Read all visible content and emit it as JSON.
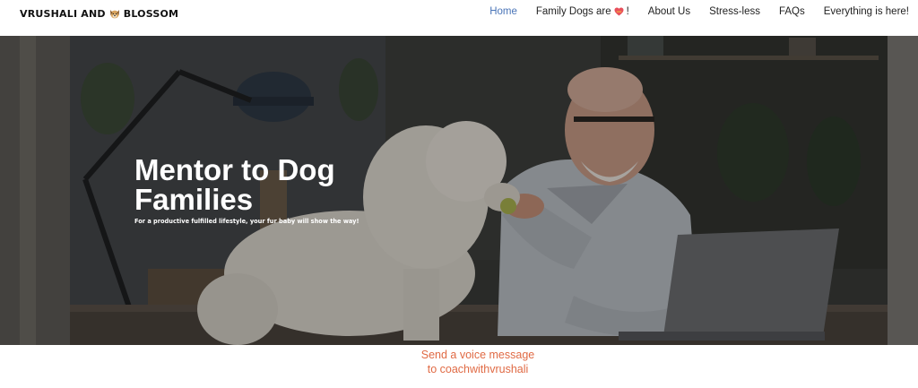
{
  "header": {
    "logo_prefix": "VRUSHALI AND",
    "logo_suffix": "BLOSSOM",
    "logo_icon": "dog-face-icon"
  },
  "nav": {
    "home": "Home",
    "family_dogs": "Family Dogs are",
    "family_dogs_suffix": "!",
    "about": "About Us",
    "stress": "Stress-less",
    "faqs": "FAQs",
    "everything": "Everything is here!"
  },
  "hero": {
    "title": "Mentor to Dog Families",
    "subtitle": "For a productive fulfilled lifestyle, your fur baby will show the way!"
  },
  "voice": {
    "line1": "Send a voice message",
    "line2": "to coachwithvrushali"
  },
  "colors": {
    "active_nav": "#4a75b8",
    "voice_link": "#e06a44"
  }
}
